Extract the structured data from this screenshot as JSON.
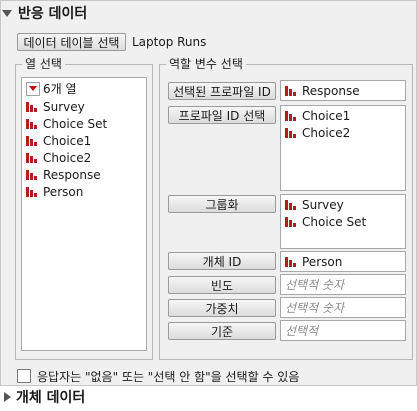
{
  "header": {
    "title": "반응 데이터"
  },
  "data_table": {
    "button_label": "데이터 테이블 선택",
    "current_table": "Laptop Runs"
  },
  "columns_panel": {
    "legend": "열 선택",
    "count_label": "6개 열",
    "items": [
      {
        "label": "Survey"
      },
      {
        "label": "Choice Set"
      },
      {
        "label": "Choice1"
      },
      {
        "label": "Choice2"
      },
      {
        "label": "Response"
      },
      {
        "label": "Person"
      }
    ]
  },
  "roles_panel": {
    "legend": "역할 변수 선택",
    "roles": {
      "selected_profile_id": {
        "button_label": "선택된 프로파일 ID",
        "values": [
          "Response"
        ]
      },
      "profile_id_select": {
        "button_label": "프로파일 ID 선택",
        "values": [
          "Choice1",
          "Choice2"
        ]
      },
      "grouping": {
        "button_label": "그룹화",
        "values": [
          "Survey",
          "Choice Set"
        ]
      },
      "subject_id": {
        "button_label": "개체 ID",
        "values": [
          "Person"
        ]
      },
      "frequency": {
        "button_label": "빈도",
        "placeholder": "선택적 숫자"
      },
      "weight": {
        "button_label": "가중치",
        "placeholder": "선택적 숫자"
      },
      "by": {
        "button_label": "기준",
        "placeholder": "선택적"
      }
    }
  },
  "options": {
    "none_option_label": "응답자는 \"없음\" 또는 \"선택 안 함\"을 선택할 수 있음"
  },
  "footer_section": {
    "title": "개체 데이터"
  },
  "colors": {
    "icon_red": "#b01e1e",
    "panel_bg": "#f0f0f0"
  }
}
